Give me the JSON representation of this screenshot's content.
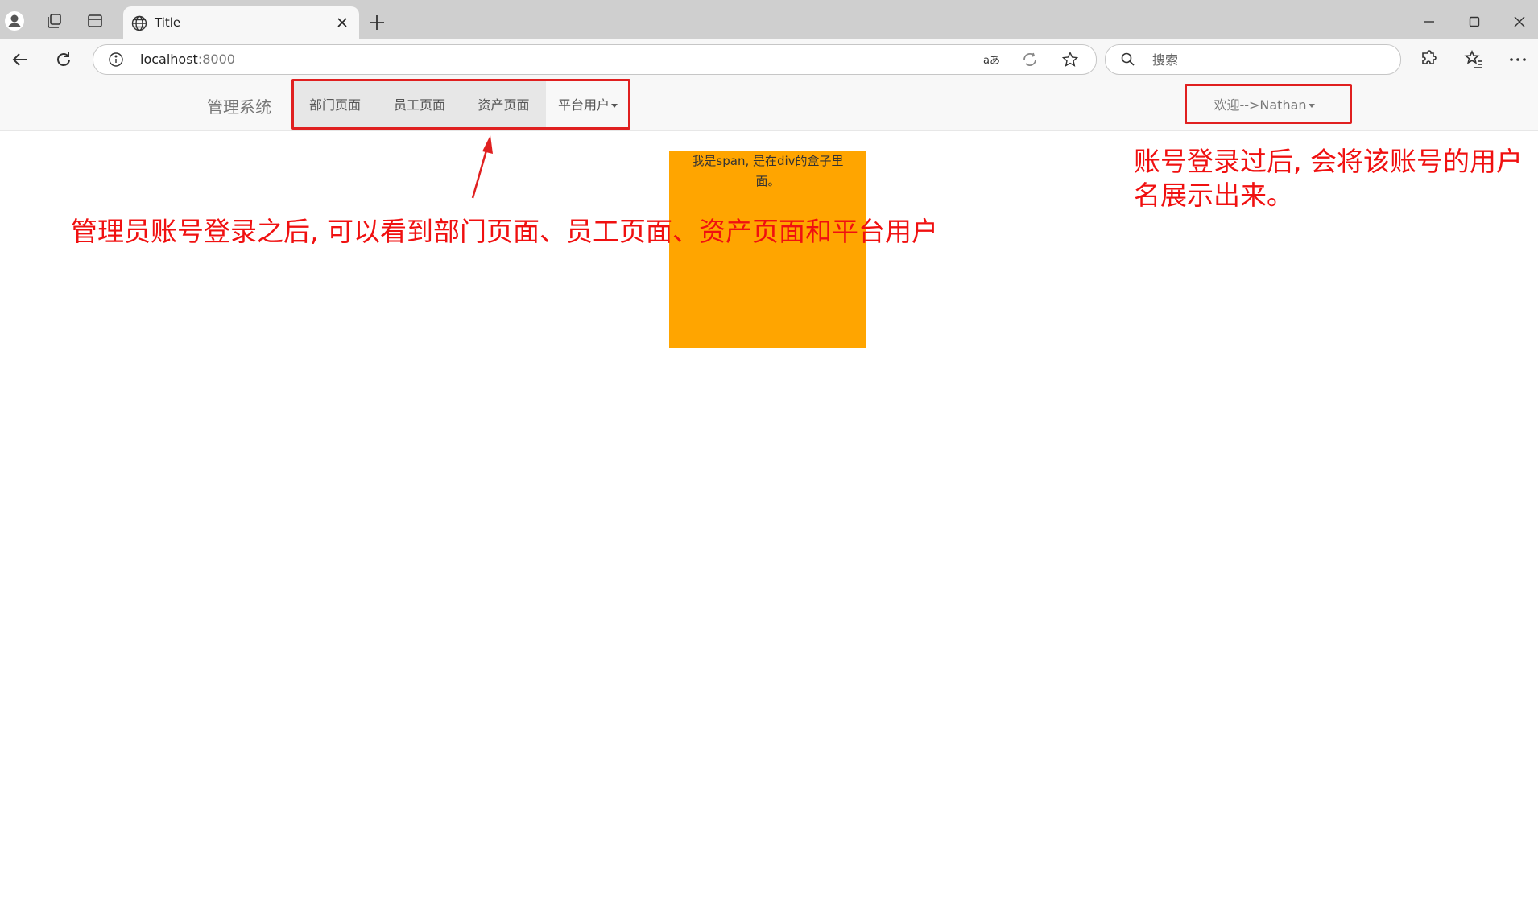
{
  "browser": {
    "tab_title": "Title",
    "address_host": "localhost",
    "address_port": ":8000",
    "search_placeholder": "搜索"
  },
  "icons": {
    "profile": "profile-icon",
    "workspaces": "workspaces-icon",
    "tab_actions": "tab-actions-icon",
    "site": "globe-icon",
    "close": "close-icon",
    "new_tab": "plus-icon",
    "back": "back-arrow-icon",
    "refresh": "refresh-icon",
    "info": "info-icon",
    "read_aloud": "read-aloud-icon",
    "copilot": "copilot-icon",
    "favorite": "star-icon",
    "search": "search-icon",
    "extensions": "extensions-icon",
    "favorites": "favorites-icon",
    "more": "more-icon"
  },
  "navbar": {
    "brand": "管理系统",
    "items": [
      {
        "label": "部门页面"
      },
      {
        "label": "员工页面"
      },
      {
        "label": "资产页面"
      },
      {
        "label": "平台用户"
      }
    ],
    "welcome": "欢迎-->Nathan"
  },
  "content": {
    "orange_box_text": "我是span, 是在div的盒子里面。"
  },
  "annotations": {
    "left_note": "管理员账号登录之后, 可以看到部门页面、员工页面、资产页面和平台用户",
    "right_note_line1": "账号登录过后, 会将该账号的用户",
    "right_note_line2": "名展示出来。",
    "color": "#f01010"
  },
  "colors": {
    "orange_box": "#ffa500",
    "annotation_red": "#e02020"
  }
}
